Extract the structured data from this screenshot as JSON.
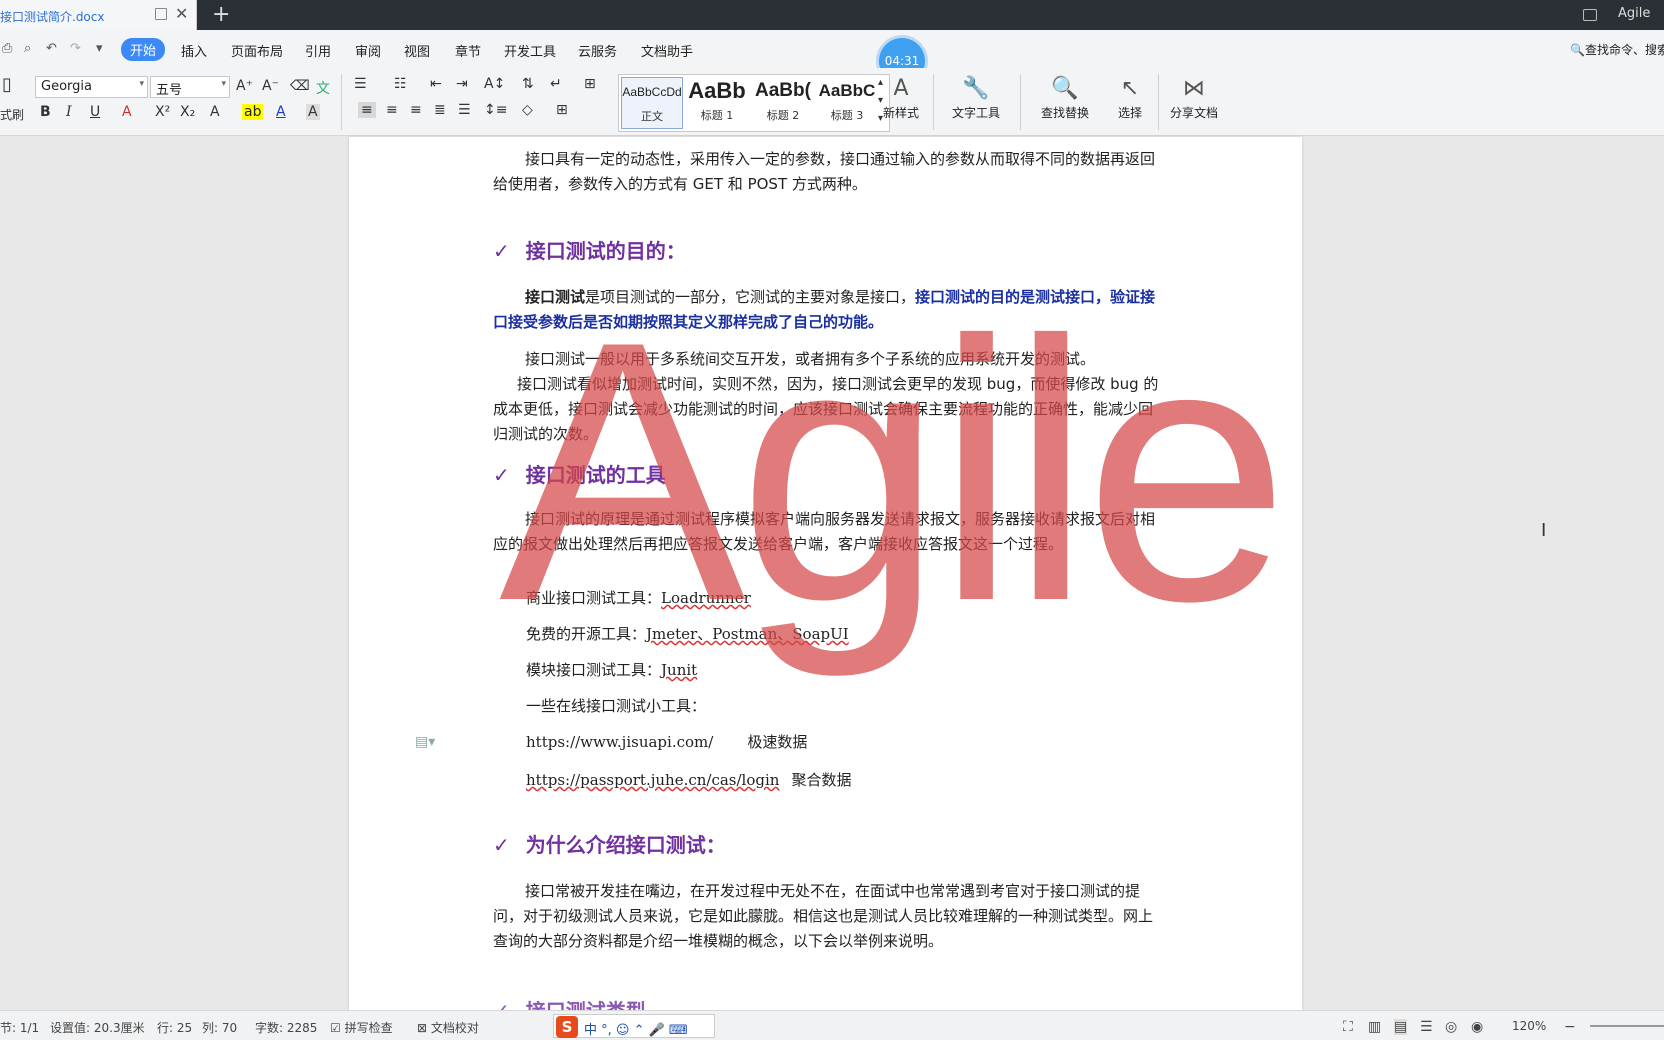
{
  "window": {
    "tab_title": "接口测试简介.docx",
    "user": "Agile"
  },
  "menu": {
    "items": [
      "开始",
      "插入",
      "页面布局",
      "引用",
      "审阅",
      "视图",
      "章节",
      "开发工具",
      "云服务",
      "文档助手"
    ],
    "search": "查找命令、搜索",
    "timer": "04:31"
  },
  "toolbar": {
    "left_label": "式刷",
    "font_name": "Georgia",
    "font_size": "五号",
    "styles": [
      {
        "sample": "AaBbCcDd",
        "label": "正文"
      },
      {
        "sample": "AaBb",
        "label": "标题 1"
      },
      {
        "sample": "AaBb(",
        "label": "标题 2"
      },
      {
        "sample": "AaBbC",
        "label": "标题 3"
      }
    ],
    "new_style": "新样式",
    "text_tools": "文字工具",
    "find_replace": "查找替换",
    "select": "选择",
    "share": "分享文档"
  },
  "document": {
    "p1": "接口具有一定的动态性，采用传入一定的参数，接口通过输入的参数从而取得不同的数据再返回给使用者，参数传入的方式有 GET 和 POST 方式两种。",
    "h1": "接口测试的目的：",
    "p2_bold": "接口测试",
    "p2_normal": "是项目测试的一部分，它测试的主要对象是接口，",
    "p2_blue": "接口测试的目的是测试接口，验证接口接受参数后是否如期按照其定义那样完成了自己的功能。",
    "p3": "接口测试一般以用于多系统间交互开发，或者拥有多个子系统的应用系统开发的测试。",
    "p4": "接口测试看似增加测试时间，实则不然，因为，接口测试会更早的发现 bug，而使得修改 bug 的成本更低，接口测试会减少功能测试的时间，应该接口测试会确保主要流程功能的正确性，能减少回归测试的次数。",
    "h2": "接口测试的工具",
    "p5": "接口测试的原理是通过测试程序模拟客户端向服务器发送请求报文，服务器接收请求报文后对相应的报文做出处理然后再把应答报文发送给客户端，客户端接收应答报文这一个过程。",
    "l1_label": "商业接口测试工具：",
    "l1_value": "Loadrunner",
    "l2_label": "免费的开源工具：",
    "l2_value": "Jmeter、Postman、SoapUI",
    "l3_label": "模块接口测试工具：",
    "l3_value": "Junit",
    "l4": "一些在线接口测试小工具：",
    "l5_url": "https://www.jisuapi.com/",
    "l5_name": "极速数据",
    "l6_url": "https://passport.juhe.cn/cas/login",
    "l6_name": "聚合数据",
    "h3": "为什么介绍接口测试：",
    "p6": "接口常被开发挂在嘴边，在开发过程中无处不在，在面试中也常常遇到考官对于接口测试的提问，对于初级测试人员来说，它是如此朦胧。相信这也是测试人员比较难理解的一种测试类型。网上查询的大部分资料都是介绍一堆模糊的概念，以下会以举例来说明。",
    "h4_partial": "接口测试类型",
    "checkmark": "✓",
    "watermark": "Agile"
  },
  "status": {
    "section": "节: 1/1",
    "setting": "设置值: 20.3厘米",
    "row": "行: 25",
    "col": "列: 70",
    "words": "字数: 2285",
    "spell": "拼写检查",
    "proof": "文档校对",
    "ime": "中 °, ☺ ⌃ 🎤 ⌨",
    "zoom": "120%"
  }
}
